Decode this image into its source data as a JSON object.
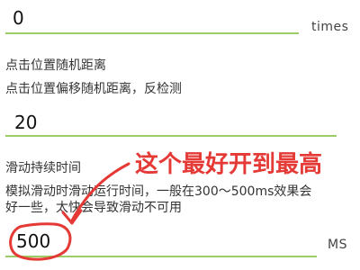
{
  "click_count": {
    "value": "0",
    "unit": "times"
  },
  "offset_section": {
    "title": "点击位置随机距离",
    "description": "点击位置偏移随机距离，反检测",
    "value": "20"
  },
  "slide_section": {
    "title": "滑动持续时间",
    "description_line1": "模拟滑动时滑动运行时间，一般在300～500ms效果会",
    "description_line2": "好一些，太快会导致滑动不可用",
    "value": "500",
    "unit": "MS"
  },
  "annotation": {
    "text": "这个最好开到最高",
    "color": "#e53935"
  },
  "accent_color": "#9ccc65"
}
